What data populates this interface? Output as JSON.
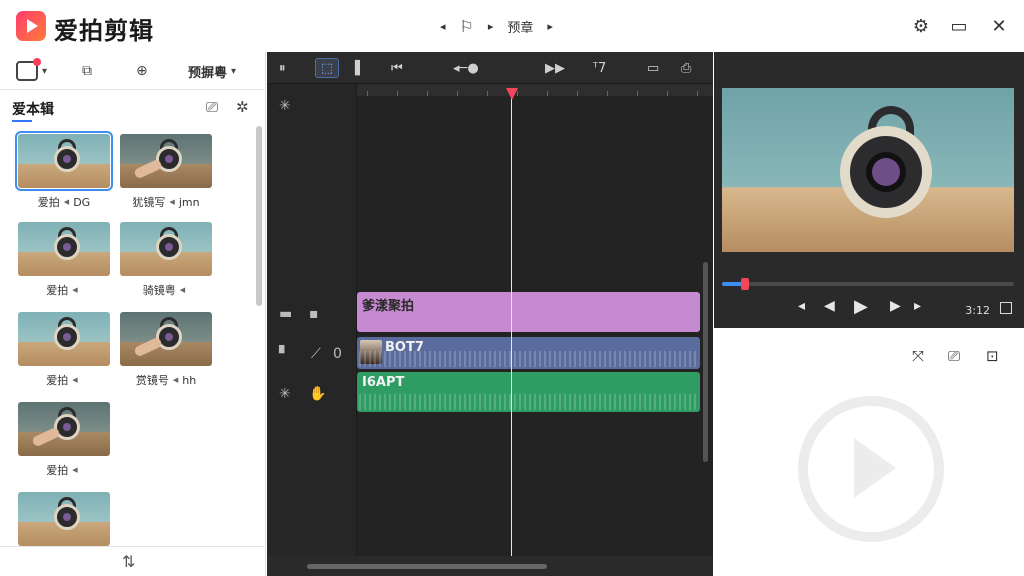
{
  "app": {
    "title": "爱拍剪辑"
  },
  "center_nav": {
    "prev": "◂",
    "play": "▸",
    "label": "预章",
    "next": "▸"
  },
  "left_panel": {
    "tab_dropdown_label": "预摒粵",
    "section_title": "爱本辑",
    "media": [
      {
        "title": "爱拍",
        "tag": "DG"
      },
      {
        "title": "犹镜写",
        "tag": "jmn"
      },
      {
        "title": "爱拍",
        "tag": ""
      },
      {
        "title": "骑镜粤",
        "tag": ""
      },
      {
        "title": "爱拍",
        "tag": ""
      },
      {
        "title": "赏镜号",
        "tag": "hh"
      },
      {
        "title": "爱拍",
        "tag": ""
      },
      {
        "title": "",
        "tag": ""
      }
    ]
  },
  "timeline": {
    "clips": [
      {
        "label": "爹漾聚拍",
        "type": "text"
      },
      {
        "label": "BOT7",
        "type": "video"
      },
      {
        "label": "I6APT",
        "type": "audio"
      }
    ],
    "track_audio_volume": "0"
  },
  "preview": {
    "progress": 0.08,
    "time": "3:12"
  }
}
